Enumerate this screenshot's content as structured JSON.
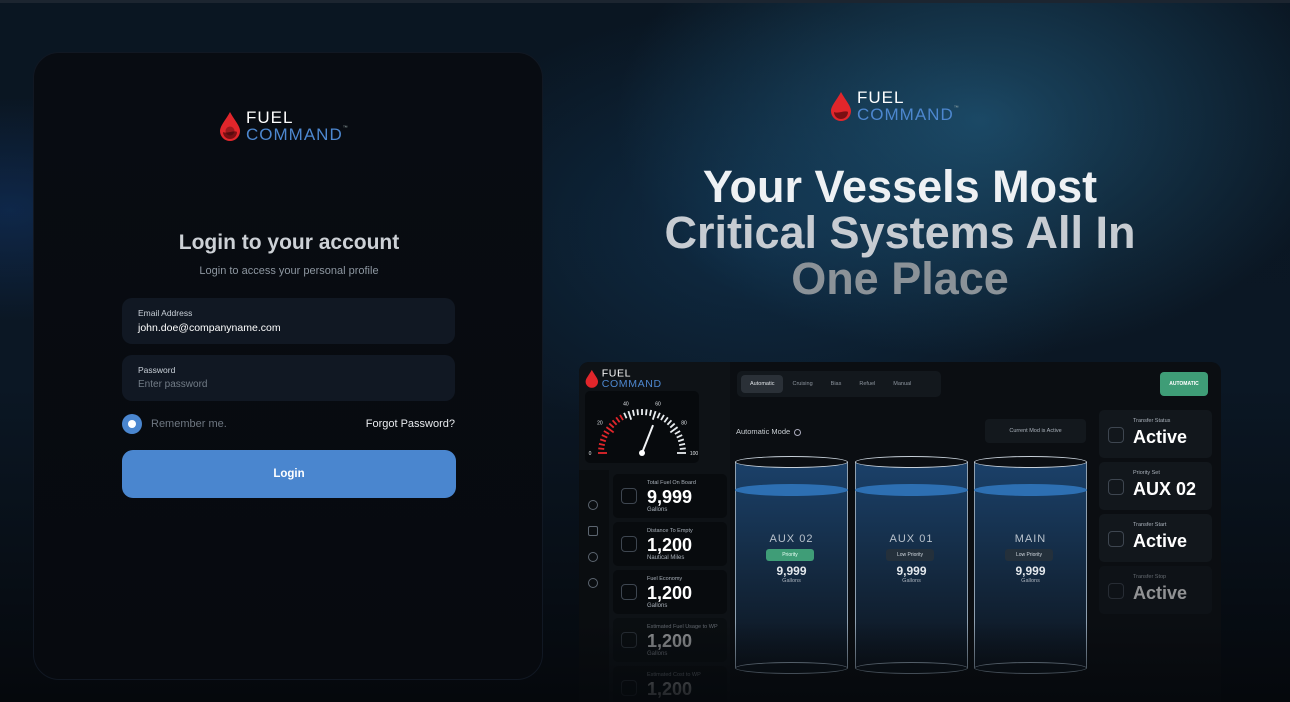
{
  "brand": {
    "word1": "FUEL",
    "word2": "COMMAND",
    "tm": "™",
    "accent": "#4a86cf",
    "drop_color": "#e1262b"
  },
  "login": {
    "title": "Login to your account",
    "subtitle": "Login to access your personal profile",
    "email_label": "Email Address",
    "email_value": "john.doe@companyname.com",
    "password_label": "Password",
    "password_placeholder": "Enter password",
    "remember_label": "Remember me.",
    "forgot_label": "Forgot Password?",
    "login_button": "Login"
  },
  "hero": {
    "line1": "Your Vessels Most",
    "line2": "Critical Systems All In",
    "line3": "One Place"
  },
  "dashboard": {
    "tabs": [
      "Automatic",
      "Cruising",
      "Bias",
      "Refuel",
      "Manual"
    ],
    "active_tab": "Automatic",
    "auto_button": "AUTOMATIC",
    "mode_label": "Automatic Mode",
    "mode_status": "Current Mod is Active",
    "gauge": {
      "ticks": [
        "0",
        "20",
        "40",
        "60",
        "80",
        "100"
      ],
      "needle_value": 62
    },
    "side_icons": [
      "gear-icon",
      "chart-icon",
      "timer-icon",
      "settings-icon"
    ],
    "stats": [
      {
        "label": "Total Fuel On Board",
        "value": "9,999",
        "unit": "Gallons",
        "icon": "fuel-icon"
      },
      {
        "label": "Distance To Empty",
        "value": "1,200",
        "unit": "Nautical Miles",
        "icon": "navigation-icon"
      },
      {
        "label": "Fuel Economy",
        "value": "1,200",
        "unit": "Gallons",
        "icon": "economy-icon"
      },
      {
        "label": "Estimated Fuel Usage to WP",
        "value": "1,200",
        "unit": "Gallons",
        "icon": "waypoint-icon"
      },
      {
        "label": "Estimated Cost to WP",
        "value": "1,200",
        "unit": "",
        "icon": "cost-icon"
      }
    ],
    "tanks": [
      {
        "name": "AUX 02",
        "badge": "Priority",
        "value": "9,999",
        "unit": "Gallons",
        "level": 0.88
      },
      {
        "name": "AUX 01",
        "badge": "Low Priority",
        "value": "9,999",
        "unit": "Gallons",
        "level": 0.88
      },
      {
        "name": "MAIN",
        "badge": "Low Priority",
        "value": "9,999",
        "unit": "Gallons",
        "level": 0.88
      }
    ],
    "status_cards": [
      {
        "label": "Transfer Status",
        "value": "Active",
        "icon": "transfer-icon"
      },
      {
        "label": "Priority Set",
        "value": "AUX 02",
        "icon": "priority-icon"
      },
      {
        "label": "Transfer Start",
        "value": "Active",
        "icon": "start-icon"
      },
      {
        "label": "Transfer Stop",
        "value": "Active",
        "icon": "power-icon"
      }
    ]
  }
}
